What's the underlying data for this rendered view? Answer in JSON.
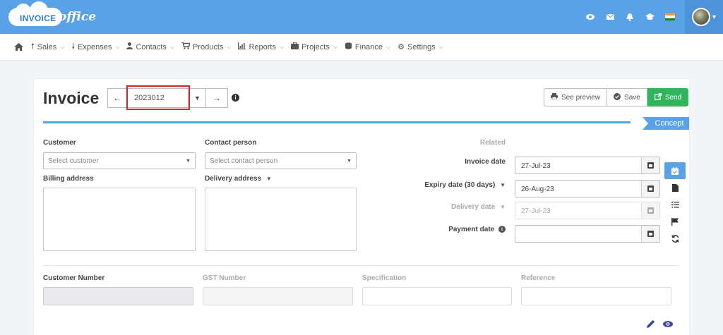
{
  "brand": {
    "part1": "INVOICE",
    "part2": "office"
  },
  "topbar": {
    "icons": [
      "eye-icon",
      "mail-icon",
      "bell-icon",
      "graduation-cap-icon"
    ],
    "flag": {
      "colors": [
        "#ff9933",
        "#ffffff",
        "#138808"
      ]
    }
  },
  "nav": {
    "items": [
      {
        "label": "Sales",
        "icon": "arrow-up-icon"
      },
      {
        "label": "Expenses",
        "icon": "arrow-down-icon"
      },
      {
        "label": "Contacts",
        "icon": "user-icon"
      },
      {
        "label": "Products",
        "icon": "cart-icon"
      },
      {
        "label": "Reports",
        "icon": "chart-icon"
      },
      {
        "label": "Projects",
        "icon": "briefcase-icon"
      },
      {
        "label": "Finance",
        "icon": "coins-icon"
      },
      {
        "label": "Settings",
        "icon": "gear-icon"
      }
    ]
  },
  "invoice": {
    "title": "Invoice",
    "number": "2023012",
    "status": "Concept"
  },
  "actions": {
    "preview": "See preview",
    "save": "Save",
    "send": "Send"
  },
  "form": {
    "customer_label": "Customer",
    "customer_placeholder": "Select customer",
    "contact_label": "Contact person",
    "contact_placeholder": "Select contact person",
    "billing_label": "Billing address",
    "delivery_addr_label": "Delivery address",
    "related_label": "Related",
    "invoice_date_label": "Invoice date",
    "invoice_date": "27-Jul-23",
    "expiry_label": "Expiry date (30 days)",
    "expiry_date": "26-Aug-23",
    "delivery_date_label": "Delivery date",
    "delivery_date": "27-Jul-23",
    "payment_label": "Payment date",
    "payment_date": ""
  },
  "footer_fields": {
    "customer_number": "Customer Number",
    "gst_number": "GST Number",
    "specification": "Specification",
    "reference": "Reference"
  },
  "colors": {
    "primary": "#5aa2e8",
    "send": "#2fb65c",
    "highlight": "#d9232b",
    "tool": "#3d4aa0"
  }
}
